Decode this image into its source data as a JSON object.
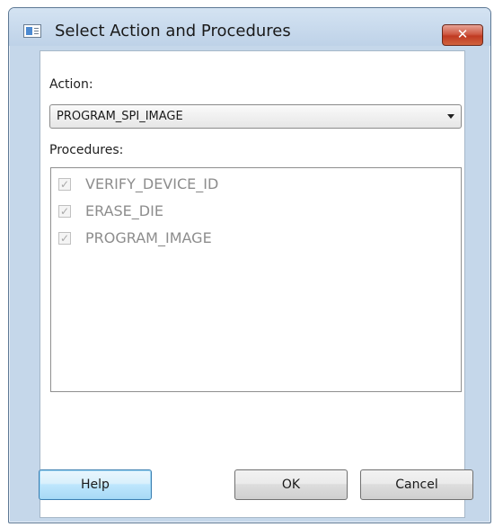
{
  "dialog": {
    "title": "Select Action and Procedures",
    "close_label": "✕"
  },
  "action": {
    "label": "Action:",
    "selected": "PROGRAM_SPI_IMAGE"
  },
  "procedures": {
    "label": "Procedures:",
    "items": [
      {
        "label": "VERIFY_DEVICE_ID",
        "checked": true,
        "enabled": false
      },
      {
        "label": "ERASE_DIE",
        "checked": true,
        "enabled": false
      },
      {
        "label": "PROGRAM_IMAGE",
        "checked": true,
        "enabled": false
      }
    ]
  },
  "buttons": {
    "help": "Help",
    "ok": "OK",
    "cancel": "Cancel"
  },
  "icons": {
    "app": "window-app-icon",
    "close": "close-icon",
    "dropdown": "chevron-down-icon",
    "check": "check-icon"
  },
  "colors": {
    "frame": "#c5d7ea",
    "close_button": "#c03a22",
    "focused_button": "#3c7fb1",
    "disabled_text": "#8d8d8d"
  }
}
